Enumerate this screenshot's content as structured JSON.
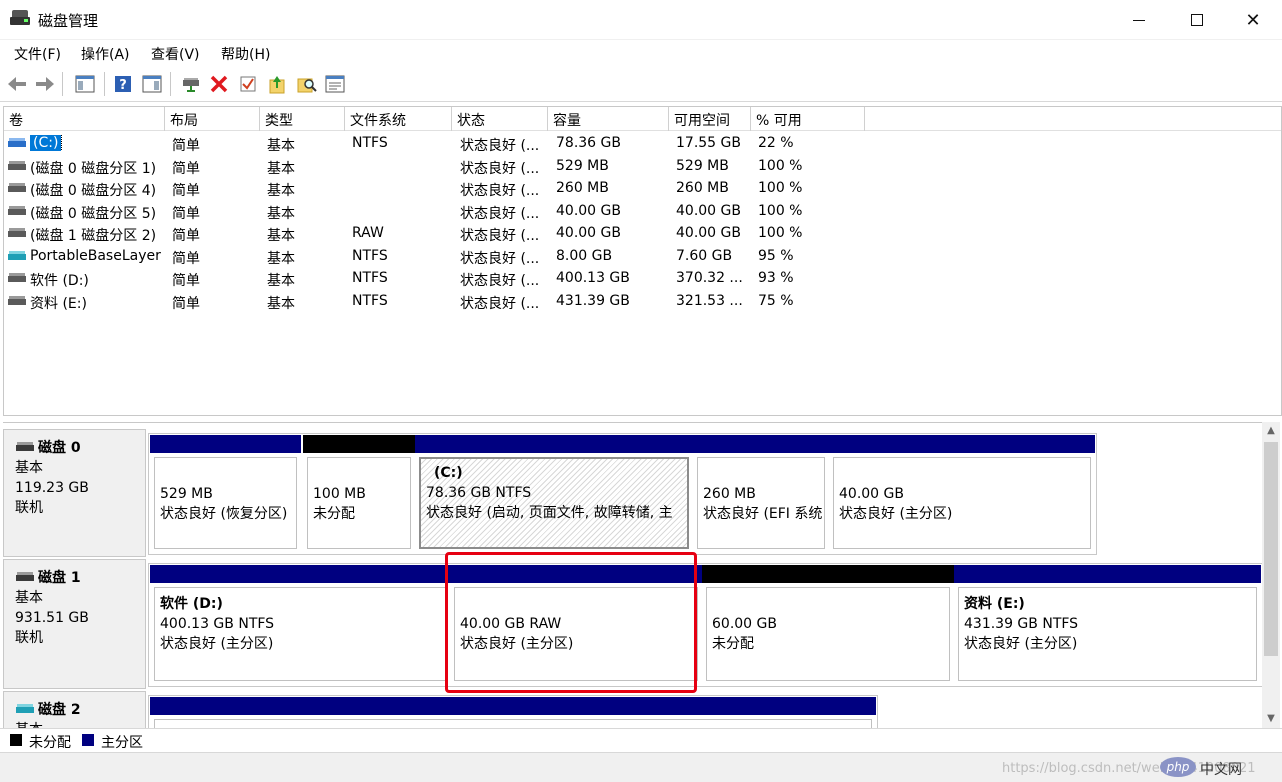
{
  "window": {
    "title": "磁盘管理"
  },
  "menu": [
    "文件(F)",
    "操作(A)",
    "查看(V)",
    "帮助(H)"
  ],
  "volume_list": {
    "columns": [
      "卷",
      "布局",
      "类型",
      "文件系统",
      "状态",
      "容量",
      "可用空间",
      "% 可用"
    ],
    "rows": [
      {
        "vol": "(C:)",
        "layout": "简单",
        "type": "基本",
        "fs": "NTFS",
        "status": "状态良好 (...",
        "capacity": "78.36 GB",
        "free": "17.55 GB",
        "pct": "22 %",
        "icon": "blue",
        "selected": true
      },
      {
        "vol": "(磁盘 0 磁盘分区 1)",
        "layout": "简单",
        "type": "基本",
        "fs": "",
        "status": "状态良好 (...",
        "capacity": "529 MB",
        "free": "529 MB",
        "pct": "100 %",
        "icon": "gray"
      },
      {
        "vol": "(磁盘 0 磁盘分区 4)",
        "layout": "简单",
        "type": "基本",
        "fs": "",
        "status": "状态良好 (...",
        "capacity": "260 MB",
        "free": "260 MB",
        "pct": "100 %",
        "icon": "gray"
      },
      {
        "vol": "(磁盘 0 磁盘分区 5)",
        "layout": "简单",
        "type": "基本",
        "fs": "",
        "status": "状态良好 (...",
        "capacity": "40.00 GB",
        "free": "40.00 GB",
        "pct": "100 %",
        "icon": "gray"
      },
      {
        "vol": "(磁盘 1 磁盘分区 2)",
        "layout": "简单",
        "type": "基本",
        "fs": "RAW",
        "status": "状态良好 (...",
        "capacity": "40.00 GB",
        "free": "40.00 GB",
        "pct": "100 %",
        "icon": "gray"
      },
      {
        "vol": "PortableBaseLayer",
        "layout": "简单",
        "type": "基本",
        "fs": "NTFS",
        "status": "状态良好 (...",
        "capacity": "8.00 GB",
        "free": "7.60 GB",
        "pct": "95 %",
        "icon": "teal"
      },
      {
        "vol": "软件 (D:)",
        "layout": "简单",
        "type": "基本",
        "fs": "NTFS",
        "status": "状态良好 (...",
        "capacity": "400.13 GB",
        "free": "370.32 ...",
        "pct": "93 %",
        "icon": "gray"
      },
      {
        "vol": "资料 (E:)",
        "layout": "简单",
        "type": "基本",
        "fs": "NTFS",
        "status": "状态良好 (...",
        "capacity": "431.39 GB",
        "free": "321.53 ...",
        "pct": "75 %",
        "icon": "gray"
      }
    ]
  },
  "disks": [
    {
      "name": "磁盘 0",
      "type": "基本",
      "size": "119.23 GB",
      "state": "联机",
      "partitions": [
        {
          "name": "",
          "line1": "529 MB",
          "line2": "状态良好 (恢复分区)",
          "kind": "primary"
        },
        {
          "name": "",
          "line1": "100 MB",
          "line2": "未分配",
          "kind": "unalloc"
        },
        {
          "name": "(C:)",
          "line1": "78.36 GB NTFS",
          "line2": "状态良好 (启动, 页面文件, 故障转储, 主",
          "kind": "primary",
          "selected": true
        },
        {
          "name": "",
          "line1": "260 MB",
          "line2": "状态良好 (EFI 系统",
          "kind": "primary"
        },
        {
          "name": "",
          "line1": "40.00 GB",
          "line2": "状态良好 (主分区)",
          "kind": "primary"
        }
      ]
    },
    {
      "name": "磁盘 1",
      "type": "基本",
      "size": "931.51 GB",
      "state": "联机",
      "partitions": [
        {
          "name": "软件 (D:)",
          "line1": "400.13 GB NTFS",
          "line2": "状态良好 (主分区)",
          "kind": "primary"
        },
        {
          "name": "",
          "line1": "40.00 GB RAW",
          "line2": "状态良好 (主分区)",
          "kind": "primary"
        },
        {
          "name": "",
          "line1": "60.00 GB",
          "line2": "未分配",
          "kind": "unalloc"
        },
        {
          "name": "资料 (E:)",
          "line1": "431.39 GB NTFS",
          "line2": "状态良好 (主分区)",
          "kind": "primary"
        }
      ]
    },
    {
      "name": "磁盘 2",
      "type": "基本"
    }
  ],
  "legend": [
    "未分配",
    "主分区"
  ],
  "colors": {
    "primary": "#000080",
    "unallocated": "#000000",
    "highlight": "#e60012",
    "selection": "#0078d7"
  },
  "watermark": "https://blog.csdn.net/weixin_41008021",
  "php_badge": {
    "logo": "php",
    "text": "中文网"
  }
}
